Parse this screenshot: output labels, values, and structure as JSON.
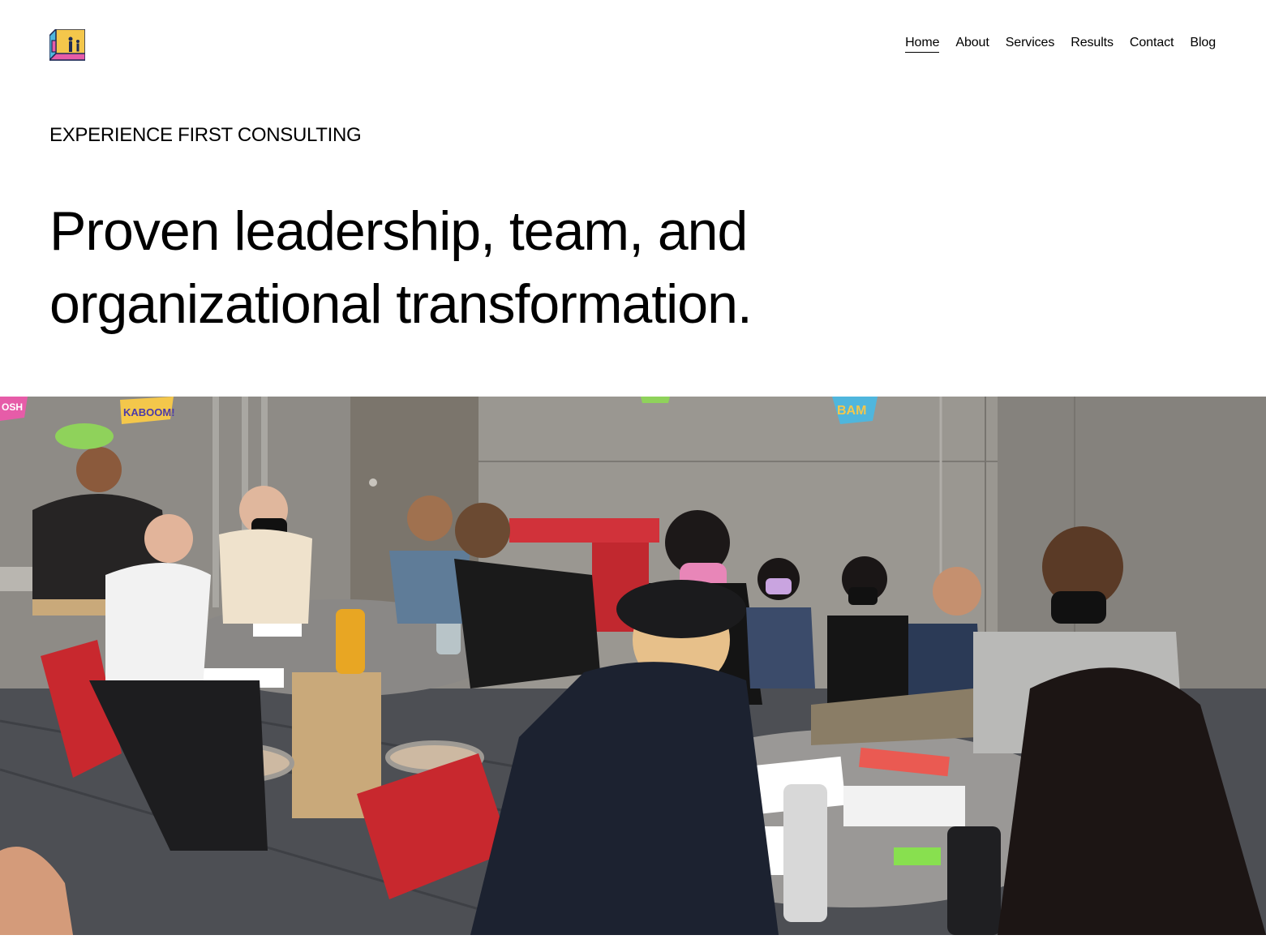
{
  "brand": {
    "logo_icon": "house-people-logo-icon"
  },
  "nav": {
    "items": [
      {
        "label": "Home",
        "active": true
      },
      {
        "label": "About",
        "active": false
      },
      {
        "label": "Services",
        "active": false
      },
      {
        "label": "Results",
        "active": false
      },
      {
        "label": "Contact",
        "active": false
      },
      {
        "label": "Blog",
        "active": false
      }
    ]
  },
  "hero": {
    "eyebrow": "EXPERIENCE FIRST CONSULTING",
    "headline": "Proven leadership, team, and organizational transformation."
  },
  "photo": {
    "signs": [
      "OSH",
      "KABOOM!",
      "BAM"
    ]
  },
  "colors": {
    "text": "#000000",
    "background": "#ffffff",
    "wall": "#8e8b86",
    "floor": "#4d4f54",
    "table": "#8a8886",
    "chair_red": "#c8282e"
  }
}
